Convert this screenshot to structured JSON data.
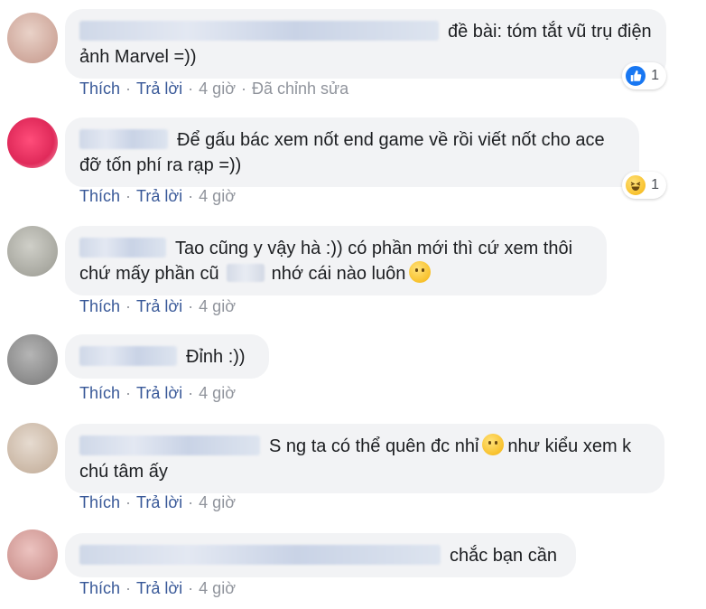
{
  "actions": {
    "like": "Thích",
    "reply": "Trả lời",
    "sep": "·"
  },
  "comments": [
    {
      "text": "đề bài: tóm tắt vũ trụ điện ảnh Marvel =))",
      "time": "4 giờ",
      "edited": "Đã chỉnh sửa",
      "reaction": {
        "icon": "like-icon",
        "count": "1"
      },
      "avatar_color": "#d9b9ae"
    },
    {
      "text": "Để gấu bác xem nốt end game về rồi viết nốt cho ace đỡ tốn phí ra rạp =))",
      "time": "4 giờ",
      "reaction": {
        "icon": "haha-icon",
        "count": "1"
      },
      "avatar_color": "#e83060"
    },
    {
      "text_a": "Tao cũng y vậy hà :)) có phần mới thì cứ xem thôi chứ mấy phần cũ",
      "text_b": "nhớ cái nào luôn",
      "time": "4 giờ",
      "avatar_color": "#b3b3ad"
    },
    {
      "text": "Đỉnh :))",
      "time": "4 giờ",
      "avatar_color": "#8f8f8f"
    },
    {
      "text_a": "S ng ta có thể quên đc nhỉ",
      "text_b": "như kiểu xem k chú tâm ấy",
      "time": "4 giờ",
      "avatar_color": "#d8c9bb"
    },
    {
      "text": "chắc bạn cần",
      "time": "4 giờ",
      "avatar_color": "#d5a3a0"
    }
  ]
}
